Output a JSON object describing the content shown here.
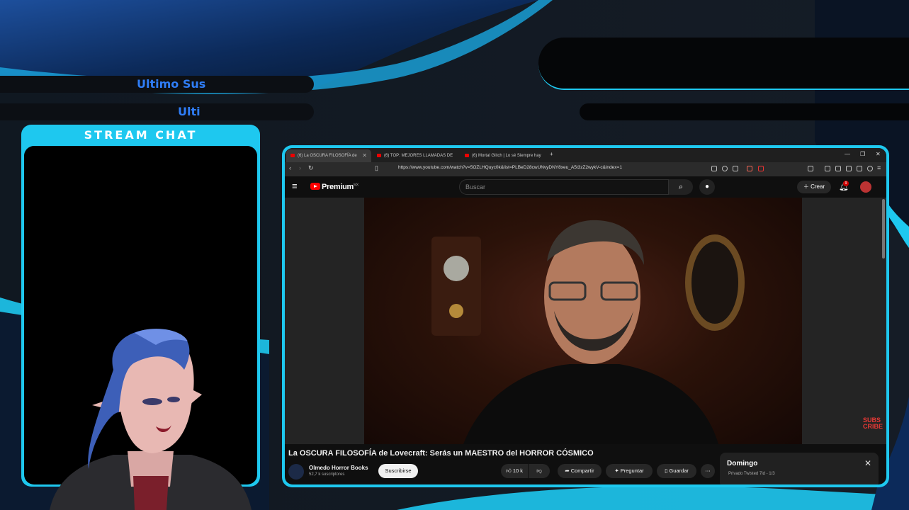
{
  "overlay": {
    "ticker_1": "Ultimo Sus",
    "ticker_2": "Ulti",
    "chat_title": "STREAM CHAT",
    "accent_color": "#1ec8ef"
  },
  "browser": {
    "tabs": [
      {
        "label": "(6) La OSCURA FILOSOFÍA de",
        "active": true
      },
      {
        "label": "(6) TOP: MEJORES LLAMADAS DE",
        "active": false
      },
      {
        "label": "(6) Mortal Glitch | Lo sé Siempre hay",
        "active": false
      }
    ],
    "url": "https://www.youtube.com/watch?v=5OZLHQuyc0k&list=PLBeD28cwUNvyDNY8xeu_A5t3zZ2wykV-c&index=1"
  },
  "youtube": {
    "logo_text": "Premium",
    "logo_sup": "MX",
    "search_placeholder": "Buscar",
    "create_label": "Crear",
    "notification_count": "9",
    "video_title": "La OSCURA FILOSOFÍA de Lovecraft: Serás un MAESTRO del HORROR CÓSMICO",
    "channel_name": "Olmedo Horror Books",
    "channel_subs": "52,7 k suscriptores",
    "subscribe_label": "Suscribirse",
    "likes": "10 k",
    "share_label": "Compartir",
    "ask_label": "Preguntar",
    "save_label": "Guardar",
    "watermark": "SUBS CRIBE",
    "playlist": {
      "title": "Domingo",
      "subtitle": "Privado  Twisted 7id - 1/3"
    }
  }
}
